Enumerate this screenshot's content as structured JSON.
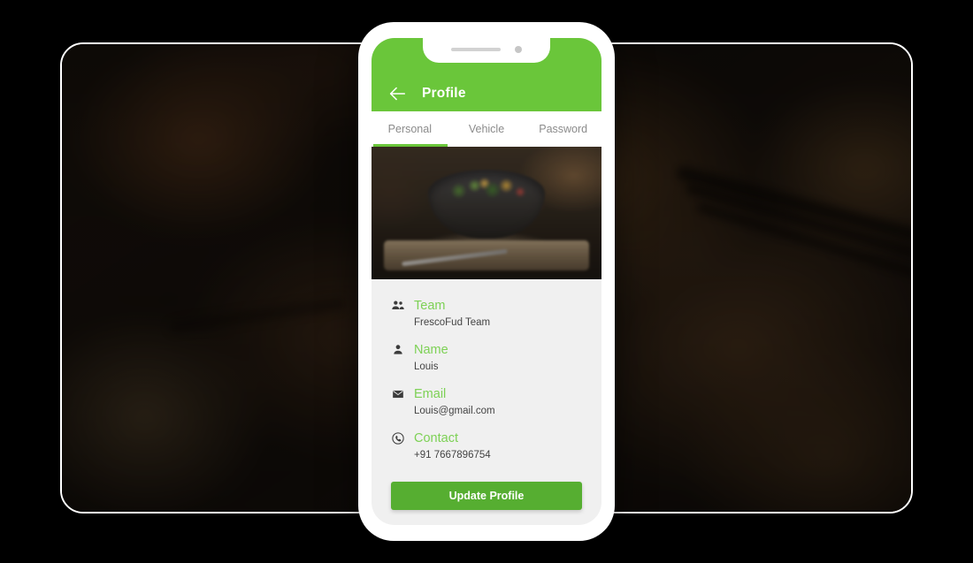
{
  "app": {
    "header": {
      "title": "Profile",
      "back_icon": "arrow-left-icon",
      "accent_color": "#6ac63a"
    },
    "tabs": [
      {
        "label": "Personal",
        "active": true
      },
      {
        "label": "Vehicle",
        "active": false
      },
      {
        "label": "Password",
        "active": false
      }
    ],
    "hero": {
      "alt": "bowl-of-salad-on-wooden-board"
    },
    "info": [
      {
        "icon": "users-group-icon",
        "label": "Team",
        "value": "FrescoFud Team"
      },
      {
        "icon": "user-icon",
        "label": "Name",
        "value": "Louis"
      },
      {
        "icon": "envelope-icon",
        "label": "Email",
        "value": "Louis@gmail.com"
      },
      {
        "icon": "phone-circle-icon",
        "label": "Contact",
        "value": "+91 7667896754"
      }
    ],
    "actions": {
      "update_label": "Update Profile",
      "update_color": "#56ae31"
    },
    "label_color": "#7dd155",
    "value_color": "#444444"
  },
  "background": {
    "device": "tablet-frame",
    "photo_alt": "blurred-roasted-food-photograph"
  }
}
